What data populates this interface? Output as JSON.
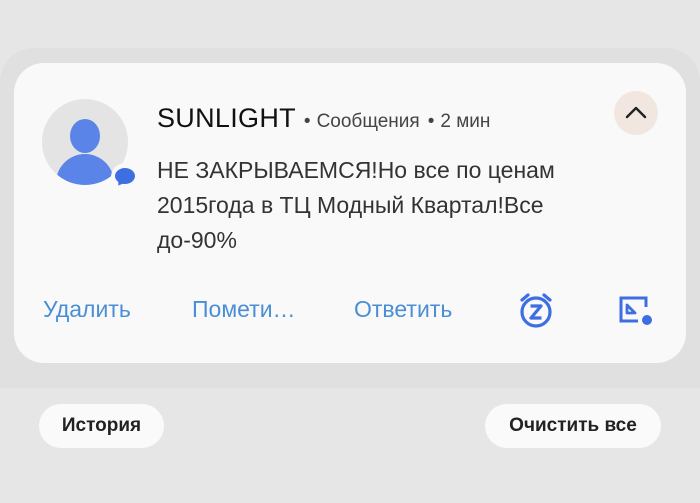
{
  "notification": {
    "sender": "SUNLIGHT",
    "app": "Сообщения",
    "time": "2 мин",
    "separator": "•",
    "message": "НЕ ЗАКРЫВАЕМСЯ!Но все по ценам 2015года в ТЦ Модный Квартал!Все до-90%",
    "actions": {
      "delete": "Удалить",
      "mark": "Помети…",
      "reply": "Ответить"
    },
    "icons": {
      "avatar": "contact-avatar-icon",
      "badge": "messages-badge-icon",
      "collapse": "chevron-up-icon",
      "snooze": "snooze-alarm-icon",
      "popup": "popup-view-icon"
    }
  },
  "footer": {
    "history": "История",
    "clear_all": "Очистить все"
  },
  "colors": {
    "accent": "#4a8fd6",
    "icon_blue": "#3e6fe2",
    "card": "#f9f9f9",
    "background": "#e6e6e6"
  }
}
